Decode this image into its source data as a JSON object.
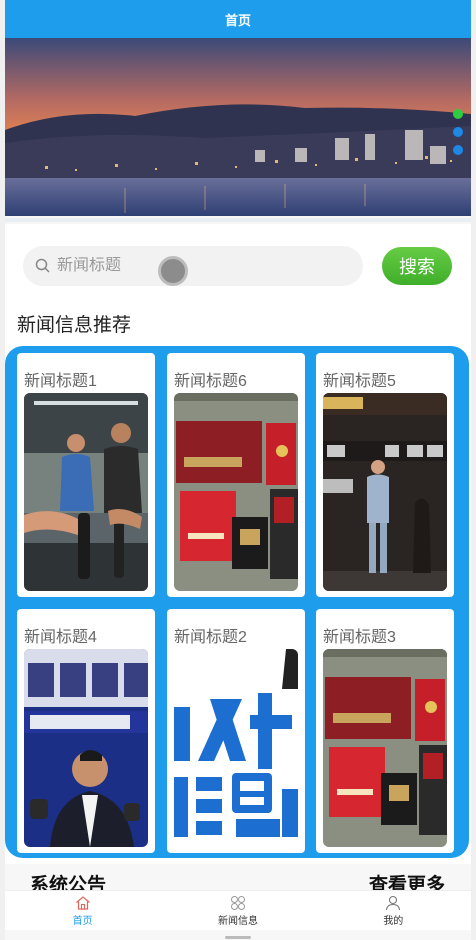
{
  "header": {
    "title": "首页"
  },
  "banner": {
    "slides": 3,
    "active_index": 0,
    "colors": {
      "active": "#2ecc40",
      "inactive": "#1e88e5"
    }
  },
  "search": {
    "placeholder": "新闻标题",
    "value": "",
    "button_label": "搜索"
  },
  "recommend": {
    "heading": "新闻信息推荐",
    "items": [
      {
        "title": "新闻标题1",
        "image": "gym-people"
      },
      {
        "title": "新闻标题6",
        "image": "graduation-certificates"
      },
      {
        "title": "新闻标题5",
        "image": "stage-speaker"
      },
      {
        "title": "新闻标题4",
        "image": "disease-prevention-officer"
      },
      {
        "title": "新闻标题2",
        "image": "personal-info-text"
      },
      {
        "title": "新闻标题3",
        "image": "graduation-certificates"
      }
    ]
  },
  "notice": {
    "title": "系统公告",
    "more_label": "查看更多"
  },
  "tabbar": {
    "tabs": [
      {
        "label": "首页",
        "icon": "home-icon",
        "active": true
      },
      {
        "label": "新闻信息",
        "icon": "grid-icon",
        "active": false
      },
      {
        "label": "我的",
        "icon": "user-icon",
        "active": false
      }
    ]
  },
  "colors": {
    "primary": "#1e9ded",
    "search_button": "#4cb832"
  }
}
